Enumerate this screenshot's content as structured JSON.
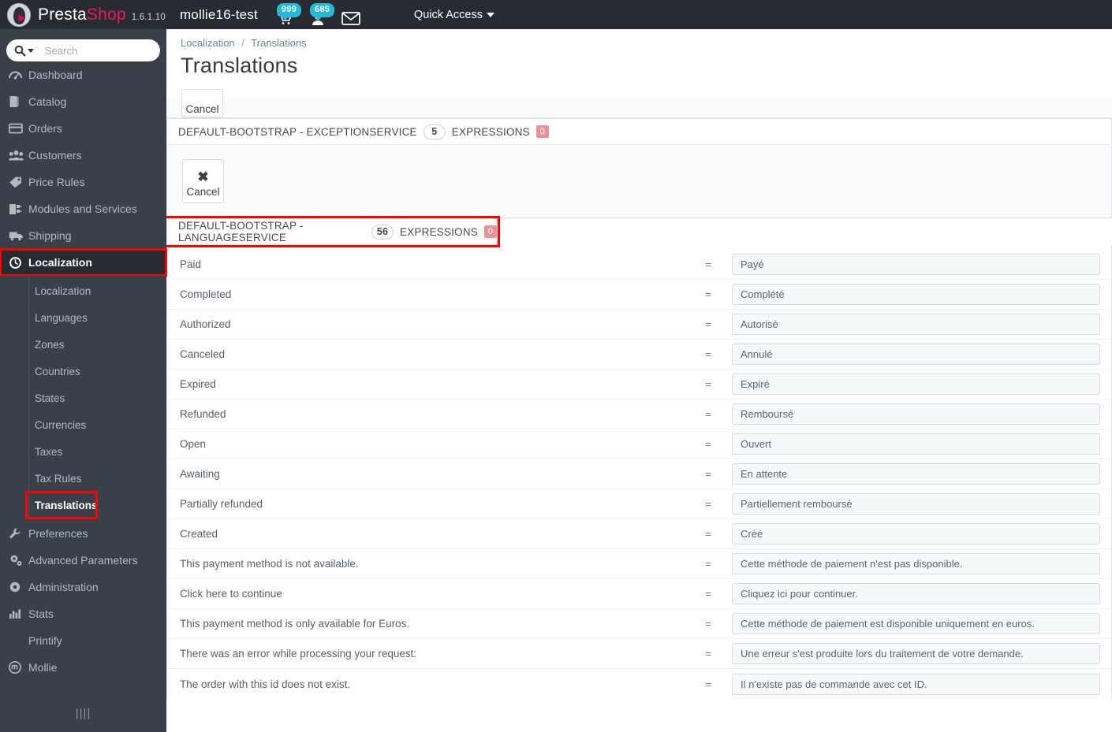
{
  "topbar": {
    "brand_primary": "Presta",
    "brand_secondary": "Shop",
    "version": "1.6.1.10",
    "shop_name": "mollie16-test",
    "cart_badge": "999",
    "customer_badge": "685",
    "quick_access_label": "Quick Access",
    "accent_pink": "#ec1a5d",
    "badge_blue": "#25b9d7"
  },
  "sidebar": {
    "search_placeholder": "Search",
    "search_value": "",
    "items": [
      {
        "label": "Dashboard",
        "icon": "dashboard-icon"
      },
      {
        "label": "Catalog",
        "icon": "catalog-icon"
      },
      {
        "label": "Orders",
        "icon": "orders-icon"
      },
      {
        "label": "Customers",
        "icon": "customers-icon"
      },
      {
        "label": "Price Rules",
        "icon": "price-rules-icon"
      },
      {
        "label": "Modules and Services",
        "icon": "modules-icon"
      },
      {
        "label": "Shipping",
        "icon": "shipping-icon"
      },
      {
        "label": "Localization",
        "icon": "localization-icon"
      }
    ],
    "submenu": [
      {
        "label": "Localization"
      },
      {
        "label": "Languages"
      },
      {
        "label": "Zones"
      },
      {
        "label": "Countries"
      },
      {
        "label": "States"
      },
      {
        "label": "Currencies"
      },
      {
        "label": "Taxes"
      },
      {
        "label": "Tax Rules"
      },
      {
        "label": "Translations"
      }
    ],
    "items_after": [
      {
        "label": "Preferences",
        "icon": "wrench-icon"
      },
      {
        "label": "Advanced Parameters",
        "icon": "cogs-icon"
      },
      {
        "label": "Administration",
        "icon": "gear-icon"
      },
      {
        "label": "Stats",
        "icon": "stats-icon"
      },
      {
        "label": "Printify",
        "icon": "printify-icon"
      },
      {
        "label": "Mollie",
        "icon": "mollie-icon"
      }
    ],
    "collapse_glyph": "||||",
    "highlight_color": "#ff0000"
  },
  "breadcrumb": {
    "parent": "Localization",
    "separator": "/",
    "current": "Translations"
  },
  "page_title": "Translations",
  "toolbar": {
    "cancel_label": "Cancel"
  },
  "panels": [
    {
      "title": "DEFAULT-BOOTSTRAP - EXCEPTIONSERVICE",
      "count": "5",
      "expressions_label": "EXPRESSIONS",
      "missing_badge": "0",
      "cancel_label": "Cancel",
      "cancel_icon": "close-x-icon"
    },
    {
      "title": "DEFAULT-BOOTSTRAP - LANGUAGESERVICE",
      "count": "56",
      "expressions_label": "EXPRESSIONS",
      "missing_badge": "0",
      "highlighted": true
    }
  ],
  "translations": [
    {
      "key": "Paid",
      "equals": "=",
      "value": "Payé"
    },
    {
      "key": "Completed",
      "equals": "=",
      "value": "Complété"
    },
    {
      "key": "Authorized",
      "equals": "=",
      "value": "Autorisé"
    },
    {
      "key": "Canceled",
      "equals": "=",
      "value": "Annulé"
    },
    {
      "key": "Expired",
      "equals": "=",
      "value": "Expiré"
    },
    {
      "key": "Refunded",
      "equals": "=",
      "value": "Remboursé"
    },
    {
      "key": "Open",
      "equals": "=",
      "value": "Ouvert"
    },
    {
      "key": "Awaiting",
      "equals": "=",
      "value": "En attente"
    },
    {
      "key": "Partially refunded",
      "equals": "=",
      "value": "Partiellement remboursé"
    },
    {
      "key": "Created",
      "equals": "=",
      "value": "Créé"
    },
    {
      "key": "This payment method is not available.",
      "equals": "=",
      "value": "Cette méthode de paiement n'est pas disponible."
    },
    {
      "key": "Click here to continue",
      "equals": "=",
      "value": "Cliquez ici pour continuer."
    },
    {
      "key": "This payment method is only available for Euros.",
      "equals": "=",
      "value": "Cette méthode de paiement est disponible uniquement en euros."
    },
    {
      "key": "There was an error while processing your request:",
      "equals": "=",
      "value": "Une erreur s'est produite lors du traitement de votre demande."
    },
    {
      "key": "The order with this id does not exist.",
      "equals": "=",
      "value": "Il n'existe pas de commande avec cet ID."
    }
  ]
}
